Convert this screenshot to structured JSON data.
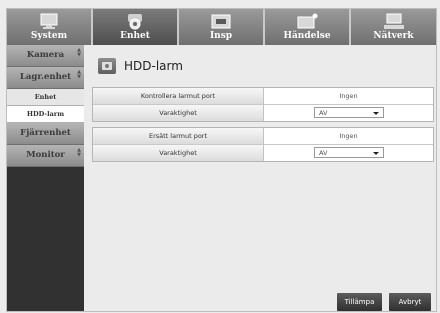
{
  "tabs": [
    {
      "label": "System",
      "icon": "monitor-icon"
    },
    {
      "label": "Enhet",
      "icon": "camera-icon"
    },
    {
      "label": "Insp",
      "icon": "rec-icon"
    },
    {
      "label": "Händelse",
      "icon": "event-icon"
    },
    {
      "label": "Nätverk",
      "icon": "network-icon"
    }
  ],
  "active_tab": "Enhet",
  "sidebar": {
    "items": [
      {
        "label": "Kamera"
      },
      {
        "label": "Lagr.enhet"
      },
      {
        "label": "Enhet"
      },
      {
        "label": "HDD-larm"
      },
      {
        "label": "Fjärrenhet"
      },
      {
        "label": "Monitor"
      }
    ],
    "selected": "HDD-larm"
  },
  "page": {
    "title": "HDD-larm",
    "icon": "hdd-icon"
  },
  "groups": [
    {
      "rows": [
        {
          "label": "Kontrollera larmut port",
          "value": "Ingen"
        },
        {
          "label": "Varaktighet",
          "value": "AV"
        }
      ]
    },
    {
      "rows": [
        {
          "label": "Ersätt larmut port",
          "value": "Ingen"
        },
        {
          "label": "Varaktighet",
          "value": "AV"
        }
      ]
    }
  ],
  "buttons": {
    "apply": "Tillämpa",
    "cancel": "Avbryt"
  },
  "colors": {
    "tabbar": "#7a7a7a",
    "sidebar": "#313131",
    "button": "#3a3a3a"
  }
}
